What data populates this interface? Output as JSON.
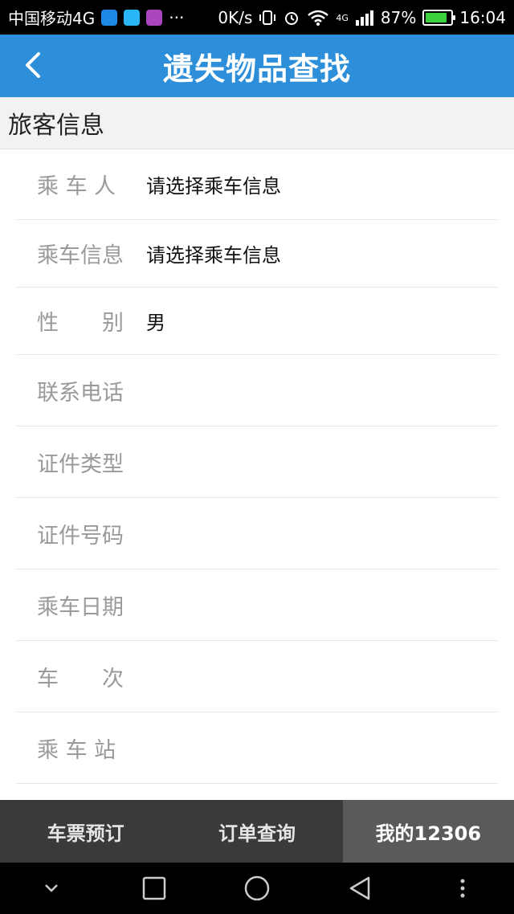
{
  "status": {
    "carrier": "中国移动4G",
    "dots": "···",
    "speed": "0K/s",
    "net_type": "4G",
    "battery": "87%",
    "battery_level": 0.87,
    "time": "16:04"
  },
  "header": {
    "title": "遗失物品查找"
  },
  "section": {
    "title": "旅客信息"
  },
  "form": {
    "rows": [
      {
        "label": "乘 车 人",
        "value": "请选择乘车信息"
      },
      {
        "label": "乘车信息",
        "value": "请选择乘车信息"
      },
      {
        "label": "性　　别",
        "value": "男"
      },
      {
        "label": "联系电话",
        "value": ""
      },
      {
        "label": "证件类型",
        "value": ""
      },
      {
        "label": "证件号码",
        "value": ""
      },
      {
        "label": "乘车日期",
        "value": ""
      },
      {
        "label": "车　　次",
        "value": ""
      },
      {
        "label": "乘 车 站",
        "value": ""
      }
    ]
  },
  "tabs": [
    {
      "label": "车票预订"
    },
    {
      "label": "订单查询"
    },
    {
      "label": "我的12306"
    }
  ],
  "colors": {
    "accent": "#2d8fd9",
    "tab_bg": "#3a3a3a",
    "tab_active": "#5a5a5a"
  }
}
